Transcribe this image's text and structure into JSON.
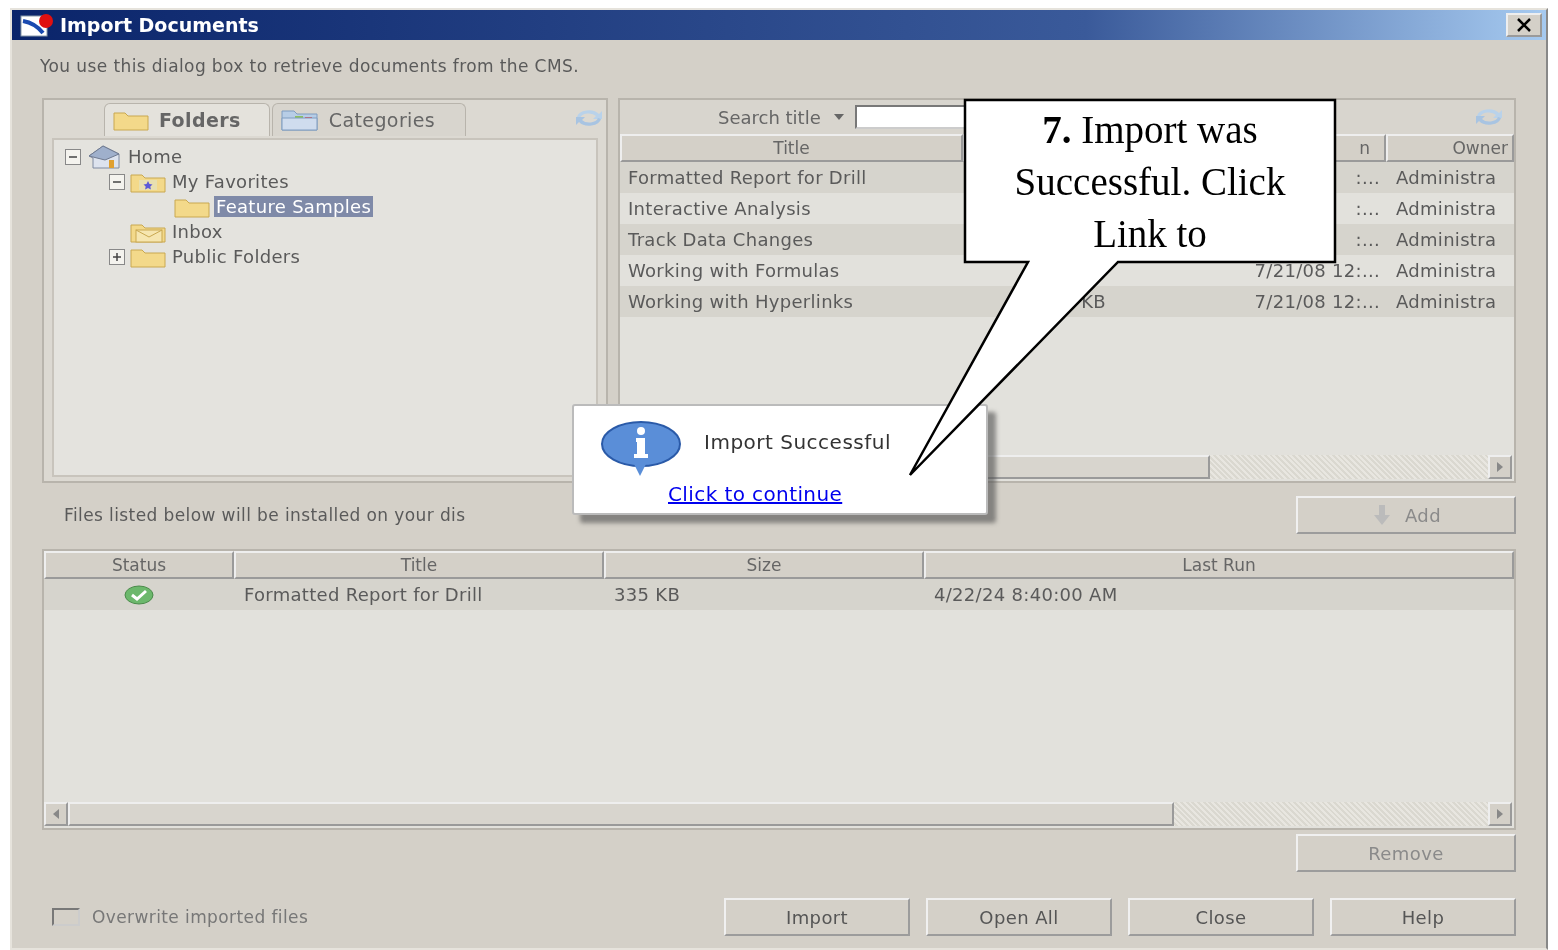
{
  "window": {
    "title": "Import Documents"
  },
  "description": "You use this dialog box to retrieve documents from the CMS.",
  "left_panel": {
    "tabs": [
      {
        "label": "Folders",
        "kind": "folder",
        "selected": true
      },
      {
        "label": "Categories",
        "kind": "categories",
        "selected": false
      }
    ],
    "tree": [
      {
        "label": "Home",
        "kind": "house",
        "expanded": true,
        "selected": false,
        "children": [
          {
            "label": "My Favorites",
            "kind": "favorites",
            "expanded": true,
            "selected": false,
            "children": [
              {
                "label": "Feature Samples",
                "kind": "folder",
                "selected": true
              }
            ]
          },
          {
            "label": "Inbox",
            "kind": "inbox",
            "selected": false
          },
          {
            "label": "Public Folders",
            "kind": "folder",
            "expanded": false,
            "selected": false
          }
        ]
      }
    ]
  },
  "right_panel": {
    "search": {
      "label": "Search title"
    },
    "column_headers": {
      "title": "Title",
      "column_3": "n",
      "owner": "Owner"
    },
    "rows": [
      {
        "title": "Formatted Report for Drill",
        "date": ":...",
        "owner": "Administra"
      },
      {
        "title": "Interactive Analysis",
        "date": ":...",
        "owner": "Administra"
      },
      {
        "title": "Track Data Changes",
        "date": ":...",
        "owner": "Administra"
      },
      {
        "title": "Working with Formulas",
        "date": "7/21/08 12:...",
        "owner": "Administra"
      },
      {
        "title": "Working with Hyperlinks",
        "size": "KB",
        "date": "7/21/08 12:...",
        "owner": "Administra"
      }
    ]
  },
  "files_note": "Files listed below will be installed on your dis",
  "add_button": {
    "label": "Add",
    "disabled": true
  },
  "files_table": {
    "columns": [
      "Status",
      "Title",
      "Size",
      "Last Run"
    ],
    "rows": [
      {
        "kind": "success",
        "title": "Formatted Report for Drill",
        "size": "335 KB",
        "last_run": "4/22/24 8:40:00 AM"
      }
    ]
  },
  "remove_button": {
    "label": "Remove",
    "disabled": true
  },
  "overwrite": {
    "label": "Overwrite imported files",
    "checked": false
  },
  "buttons": [
    {
      "label": "Import",
      "disabled": false
    },
    {
      "label": "Open All",
      "disabled": false
    },
    {
      "label": "Close",
      "disabled": false
    },
    {
      "label": "Help",
      "disabled": false
    }
  ],
  "popup": {
    "message": "Import Successful",
    "link": "Click to continue"
  },
  "callout": {
    "text": "**7.**  Import was Successful.  Click Link to"
  }
}
